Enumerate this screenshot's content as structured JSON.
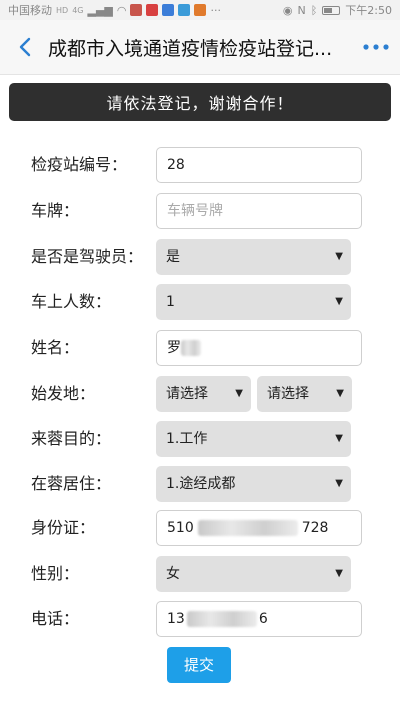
{
  "statusbar": {
    "carrier": "中国移动",
    "hd": "HD",
    "signal": "4G",
    "time": "下午2:50"
  },
  "navbar": {
    "title": "成都市入境通道疫情检疫站登记..."
  },
  "banner": {
    "text": "请依法登记，谢谢合作！"
  },
  "form": {
    "station_label": "检疫站编号：",
    "station_value": "28",
    "plate_label": "车牌：",
    "plate_placeholder": "车辆号牌",
    "driver_label": "是否是驾驶员：",
    "driver_value": "是",
    "passengers_label": "车上人数：",
    "passengers_value": "1",
    "name_label": "姓名：",
    "name_value": "罗",
    "origin_label": "始发地：",
    "origin_province": "请选择",
    "origin_city": "请选择",
    "purpose_label": "来蓉目的：",
    "purpose_value": "1.工作",
    "residence_label": "在蓉居住：",
    "residence_value": "1.途经成都",
    "idcard_label": "身份证：",
    "idcard_prefix": "510",
    "idcard_suffix": "728",
    "gender_label": "性别：",
    "gender_value": "女",
    "phone_label": "电话：",
    "phone_prefix": "13",
    "phone_suffix": "6"
  },
  "submit_label": "提交",
  "colors": {
    "banner_bg": "#2f2f2f",
    "accent": "#1e9fe8",
    "nav_icon": "#2b7fd1"
  }
}
